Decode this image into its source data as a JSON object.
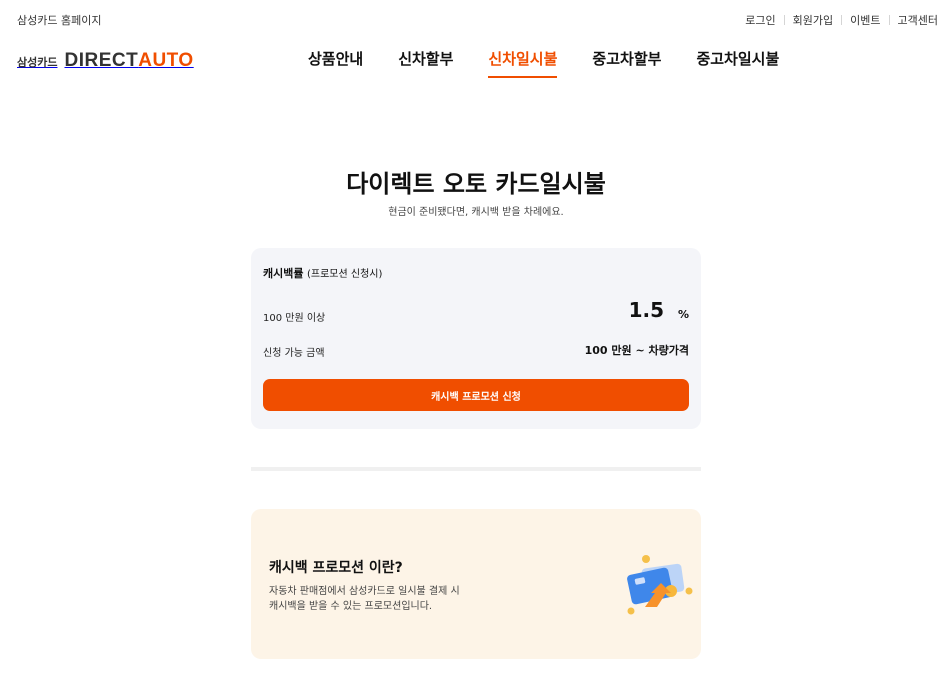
{
  "util_bar": {
    "home_link": "삼성카드 홈페이지",
    "links": [
      "로그인",
      "회원가입",
      "이벤트",
      "고객센터"
    ]
  },
  "logo": {
    "card": "삼성카드",
    "direct": "DIRECT",
    "auto": "AUTO"
  },
  "nav": {
    "items": [
      "상품안내",
      "신차할부",
      "신차일시불",
      "중고차할부",
      "중고차일시불"
    ],
    "active_index": 2
  },
  "hero": {
    "title": "다이렉트 오토 카드일시불",
    "subtitle": "현금이 준비됐다면, 캐시백 받을 차례에요."
  },
  "rate_card": {
    "heading": "캐시백률",
    "heading_note": "(프로모션 신청시)",
    "row1_label": "100 만원 이상",
    "rate": "1.5",
    "rate_unit": "%",
    "row2_label": "신청 가능 금액",
    "amount_range": "100 만원 ~ 차량가격",
    "button_label": "캐시백 프로모션 신청"
  },
  "promo": {
    "title": "캐시백 프로모션 이란?",
    "desc_line1": "자동차 판매점에서 삼성카드로 일시불 결제 시",
    "desc_line2": "캐시백을 받을 수 있는 프로모션입니다.",
    "illustration_icon": "card-cashback-icon"
  },
  "colors": {
    "accent": "#f04e00",
    "card_bg": "#f4f5f9",
    "promo_bg": "#fdf4e7"
  }
}
